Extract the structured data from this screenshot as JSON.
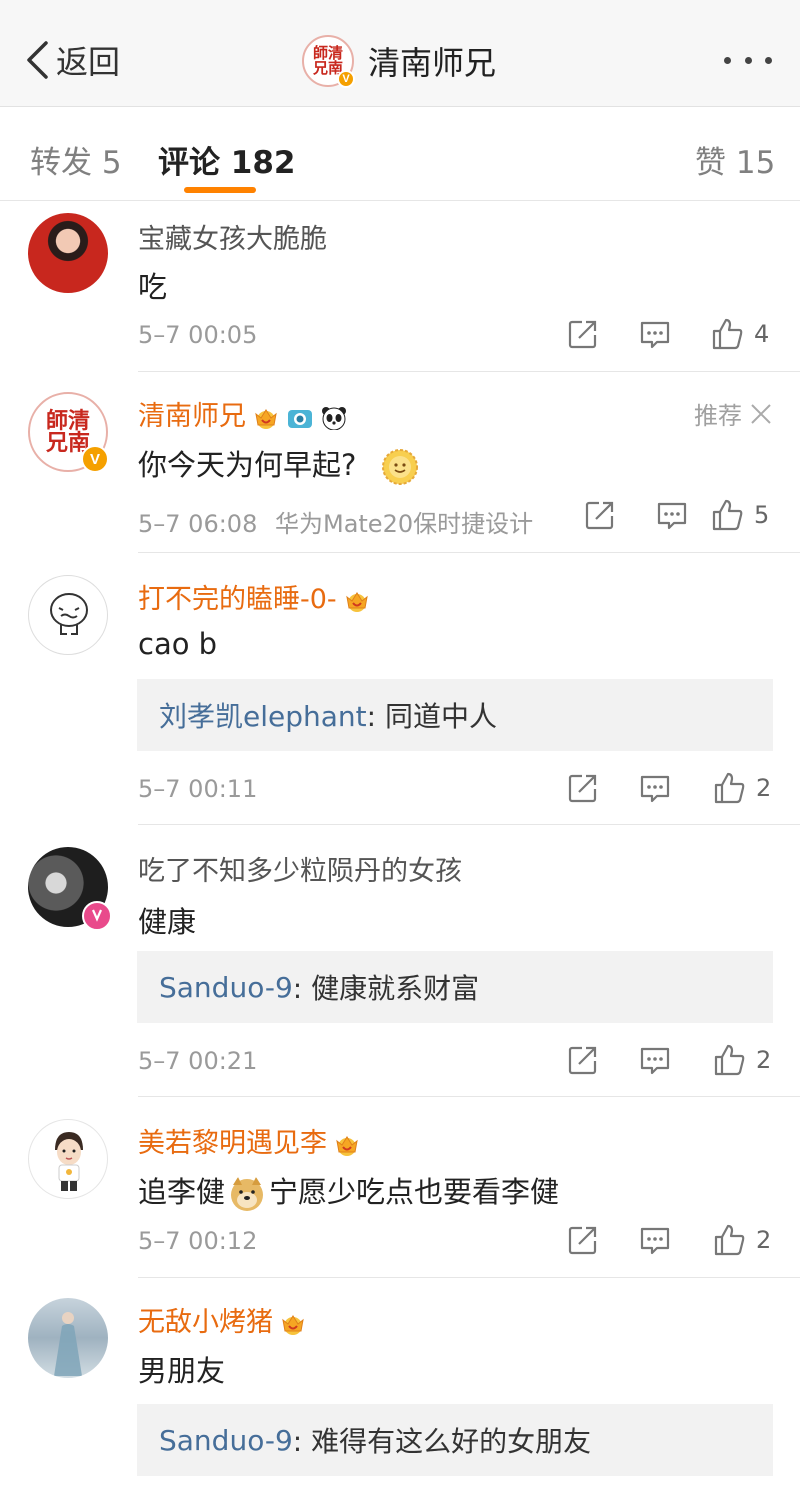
{
  "nav": {
    "back_label": "返回",
    "title": "清南师兄",
    "seal_text": "師清兄南"
  },
  "tabs": {
    "repost": "转发 5",
    "comments": "评论 182",
    "likes": "赞 15"
  },
  "colors": {
    "accent": "#ff8200",
    "vip_name": "#e86b10",
    "reply_user": "#466e99"
  },
  "comments": [
    {
      "author": "宝藏女孩大脆脆",
      "text": "吃",
      "time": "5–7 00:05",
      "likes": "4",
      "vip": false
    },
    {
      "author": "清南师兄",
      "text": "你今天为何早起?",
      "time": "5–7 06:08",
      "device": "华为Mate20保时捷设计",
      "likes": "5",
      "recommend": "推荐",
      "vip": true,
      "badges": [
        "crown-icon",
        "camera-icon",
        "panda-icon"
      ]
    },
    {
      "author": "打不完的瞌睡-0-",
      "text": "cao b",
      "reply_user": "刘孝凯elephant",
      "reply_text": ": 同道中人",
      "time": "5–7 00:11",
      "likes": "2",
      "vip": true
    },
    {
      "author": "吃了不知多少粒陨丹的女孩",
      "text": "健康",
      "reply_user": "Sanduo-9",
      "reply_text": ": 健康就系财富",
      "time": "5–7 00:21",
      "likes": "2",
      "vip": false
    },
    {
      "author": "美若黎明遇见李",
      "text_a": "追李健",
      "text_b": "宁愿少吃点也要看李健",
      "time": "5–7 00:12",
      "likes": "2",
      "vip": true
    },
    {
      "author": "无敌小烤猪",
      "text": "男朋友",
      "reply_user": "Sanduo-9",
      "reply_text": ": 难得有这么好的女朋友",
      "vip": true
    }
  ]
}
